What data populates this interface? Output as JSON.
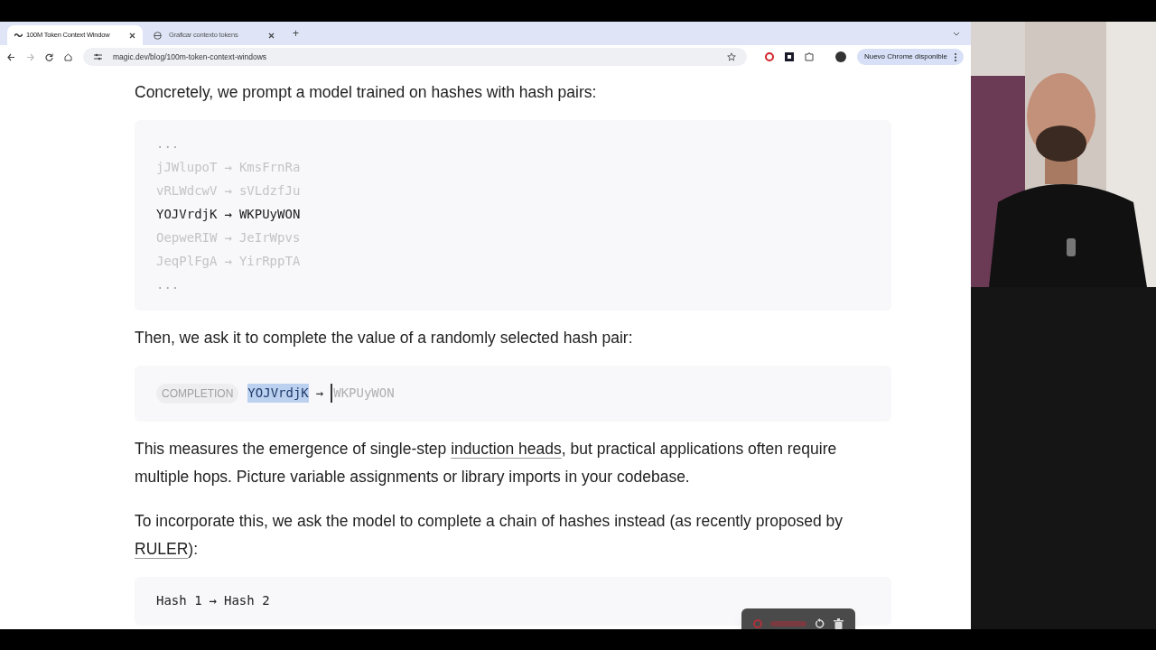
{
  "browser": {
    "tabs": [
      {
        "title": "100M Token Context Window",
        "selected": true
      },
      {
        "title": "Graficar contexto tokens",
        "selected": false
      }
    ],
    "new_tab": "+",
    "url": "magic.dev/blog/100m-token-context-windows",
    "update_button": "Nuevo Chrome disponible"
  },
  "article": [
    {
      "kind": "paragraph",
      "text": "Concretely, we prompt a model trained on hashes with hash pairs:"
    },
    {
      "kind": "code",
      "lines": [
        {
          "kind": "ellipsis",
          "text": "..."
        },
        {
          "kind": "pair",
          "key": "jJWlupoT",
          "arrow": "→",
          "value": "KmsFrnRa",
          "highlighted": false
        },
        {
          "kind": "pair",
          "key": "vRLWdcwV",
          "arrow": "→",
          "value": "sVLdzfJu",
          "highlighted": false
        },
        {
          "kind": "pair",
          "key": "YOJVrdjK",
          "arrow": "→",
          "value": "WKPUyWON",
          "highlighted": true
        },
        {
          "kind": "pair",
          "key": "OepweRIW",
          "arrow": "→",
          "value": "JeIrWpvs",
          "highlighted": false
        },
        {
          "kind": "pair",
          "key": "JeqPlFgA",
          "arrow": "→",
          "value": "YirRppTA",
          "highlighted": false
        },
        {
          "kind": "ellipsis",
          "text": "..."
        }
      ]
    },
    {
      "kind": "paragraph",
      "text": "Then, we ask it to complete the value of a randomly selected hash pair:"
    },
    {
      "kind": "completion",
      "label": "COMPLETION",
      "key": "YOJVrdjK",
      "key_selected": true,
      "arrow": "→",
      "value": "WKPUyWON"
    },
    {
      "kind": "paragraph",
      "parts": [
        {
          "text": "This measures the emergence of single-step ",
          "link": false
        },
        {
          "text": "induction heads",
          "link": true
        },
        {
          "text": ", but practical applications often require multiple hops. Picture variable assignments or library imports in your codebase.",
          "link": false
        }
      ]
    },
    {
      "kind": "paragraph",
      "parts": [
        {
          "text": "To incorporate this, we ask the model to complete a chain of hashes instead (as recently proposed by ",
          "link": false
        },
        {
          "text": "RULER",
          "link": true
        },
        {
          "text": "):",
          "link": false
        }
      ]
    },
    {
      "kind": "code",
      "lines": [
        {
          "kind": "pair",
          "key": "Hash 1",
          "arrow": "→",
          "value": "Hash 2",
          "highlighted": true
        }
      ]
    }
  ]
}
